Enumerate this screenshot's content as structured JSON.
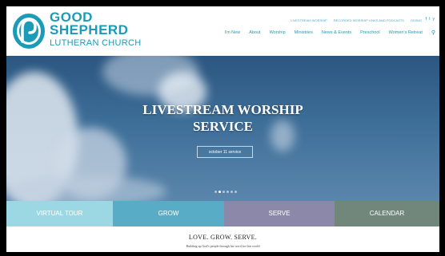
{
  "brand": {
    "line1": "GOOD",
    "line2": "SHEPHERD",
    "line3": "LUTHERAN CHURCH",
    "color": "#1b9bb6"
  },
  "utility_nav": [
    "LIVESTREAM WORSHIP",
    "RECORDED WORSHIP LINKS AND PODCASTS",
    "GIVING"
  ],
  "social": {
    "facebook": "f",
    "twitter": "t",
    "youtube": "y"
  },
  "main_nav": [
    "I'm New",
    "About",
    "Worship",
    "Ministries",
    "News & Events",
    "Preschool",
    "Women's Retreat"
  ],
  "search_glyph": "⚲",
  "hero": {
    "title_line1": "LIVESTREAM WORSHIP",
    "title_line2": "SERVICE",
    "button_label": "october 11 service",
    "active_slide": 2,
    "slide_count": 6
  },
  "tiles": [
    {
      "label": "VIRTUAL TOUR",
      "color": "#9cd8e4"
    },
    {
      "label": "GROW",
      "color": "#59acc6"
    },
    {
      "label": "SERVE",
      "color": "#8c88a9"
    },
    {
      "label": "CALENDAR",
      "color": "#71877b"
    }
  ],
  "intro": {
    "tagline": "LOVE. GROW. SERVE.",
    "subtagline": "Building up God's people through his word for this world"
  }
}
